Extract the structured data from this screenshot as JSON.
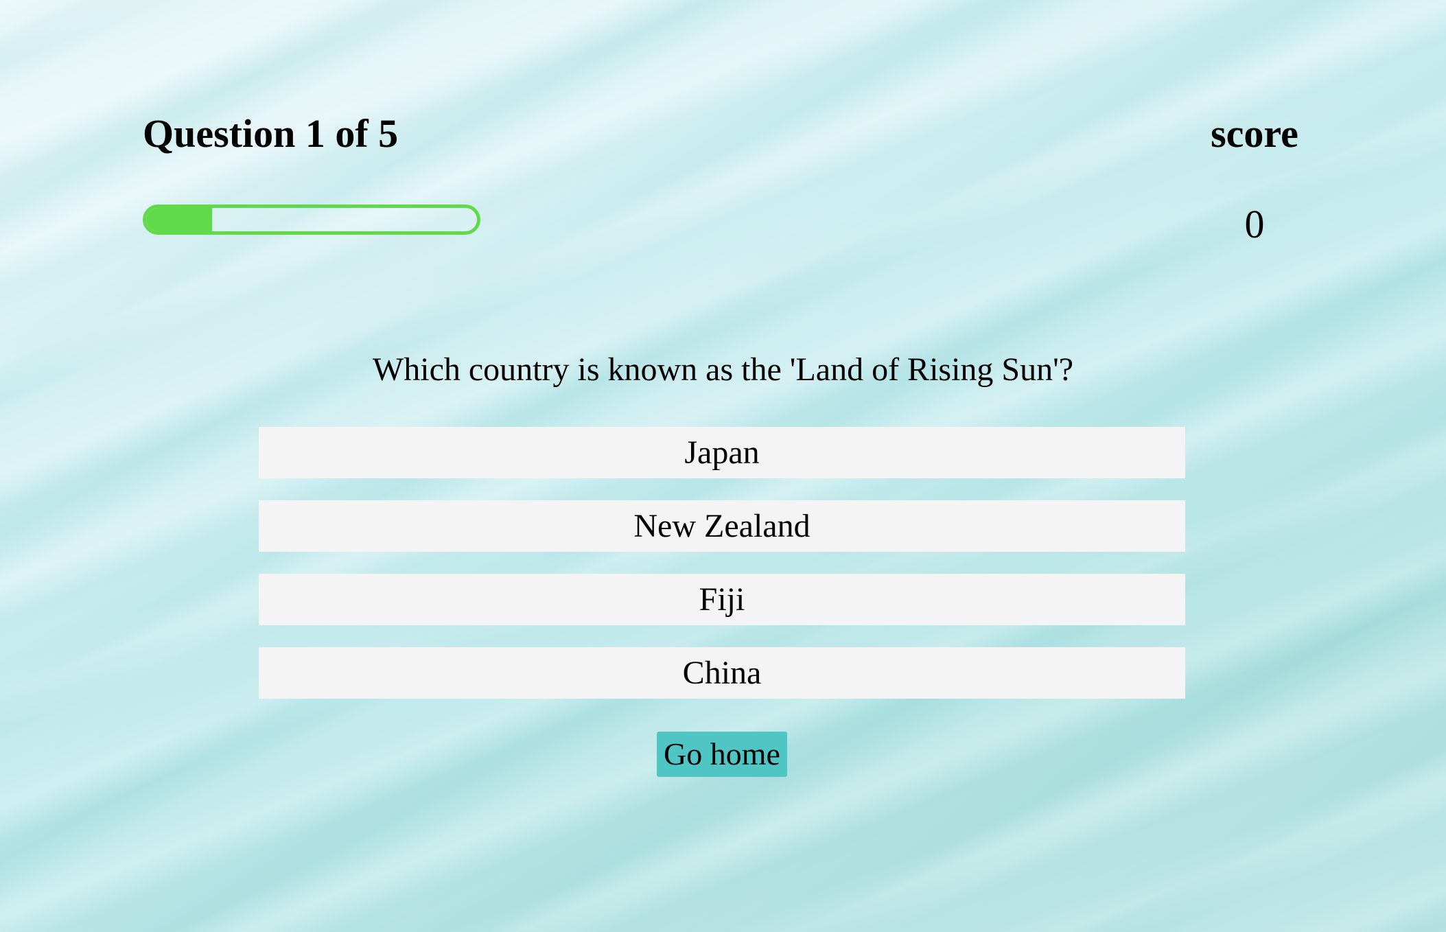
{
  "header": {
    "question_counter": "Question 1 of 5",
    "progress_fraction": 0.2,
    "progress_color": "#62d94b"
  },
  "score": {
    "label": "score",
    "value": "0"
  },
  "question": {
    "text": "Which country is known as the 'Land of Rising Sun'?",
    "options": [
      "Japan",
      "New Zealand",
      "Fiji",
      "China"
    ]
  },
  "footer": {
    "home_label": "Go home",
    "home_color": "#4fc6c3"
  }
}
